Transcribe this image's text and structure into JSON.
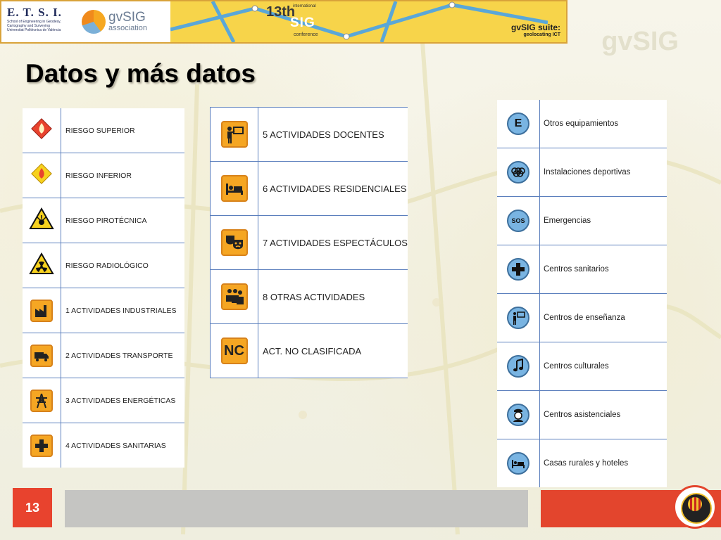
{
  "slide": {
    "title": "Datos y más datos",
    "page_number": "13"
  },
  "banner": {
    "etsi_logo": "E. T. S. I.",
    "etsi_lines": [
      "School of Engineering in Geodesy,",
      "Cartography and Surveying",
      "Universitat Politècnica de València"
    ],
    "gvsig_word": "gvSIG",
    "association": "association",
    "conference_num": "13th",
    "conference_intl": "international",
    "conference_sig": "SIG",
    "conference_word": "conference",
    "suite": "gvSIG suite:",
    "geolocating": "geolocating ICT"
  },
  "table_riesgos": [
    {
      "icon": "fire-hazard-red-icon",
      "label": "RIESGO SUPERIOR"
    },
    {
      "icon": "fire-hazard-yellow-icon",
      "label": "RIESGO INFERIOR"
    },
    {
      "icon": "explosive-warning-icon",
      "label": "RIESGO PIROTÉCNICA"
    },
    {
      "icon": "radiation-warning-icon",
      "label": "RIESGO RADIOLÓGICO"
    },
    {
      "icon": "factory-icon",
      "label": "1 ACTIVIDADES INDUSTRIALES"
    },
    {
      "icon": "truck-icon",
      "label": "2 ACTIVIDADES TRANSPORTE"
    },
    {
      "icon": "power-tower-icon",
      "label": "3 ACTIVIDADES ENERGÉTICAS"
    },
    {
      "icon": "medical-cross-icon",
      "label": "4 ACTIVIDADES SANITARIAS"
    }
  ],
  "table_actividades": [
    {
      "icon": "teacher-board-icon",
      "label": "5 ACTIVIDADES DOCENTES"
    },
    {
      "icon": "bed-icon",
      "label": "6 ACTIVIDADES RESIDENCIALES"
    },
    {
      "icon": "theater-masks-icon",
      "label": "7 ACTIVIDADES ESPECTÁCULOS"
    },
    {
      "icon": "people-group-icon",
      "label": "8 OTRAS ACTIVIDADES"
    },
    {
      "icon": "nc-icon",
      "label": "ACT. NO CLASIFICADA",
      "glyph": "NC"
    }
  ],
  "table_equipamientos": [
    {
      "icon": "letter-e-icon",
      "label": "Otros equipamientos",
      "glyph": "E"
    },
    {
      "icon": "olympic-rings-icon",
      "label": "Instalaciones deportivas"
    },
    {
      "icon": "sos-icon",
      "label": "Emergencias",
      "glyph": "SOS"
    },
    {
      "icon": "medical-cross-icon",
      "label": "Centros sanitarios"
    },
    {
      "icon": "teacher-board-icon",
      "label": "Centros de enseñanza"
    },
    {
      "icon": "music-note-icon",
      "label": "Centros culturales"
    },
    {
      "icon": "nurse-icon",
      "label": "Centros asistenciales"
    },
    {
      "icon": "bed-icon",
      "label": "Casas rurales y hoteles"
    }
  ],
  "colors": {
    "accent_red": "#e3452d",
    "orange_icon": "#f5a623",
    "blue_icon": "#79b4e2",
    "rule_blue": "#5b7fbd"
  }
}
